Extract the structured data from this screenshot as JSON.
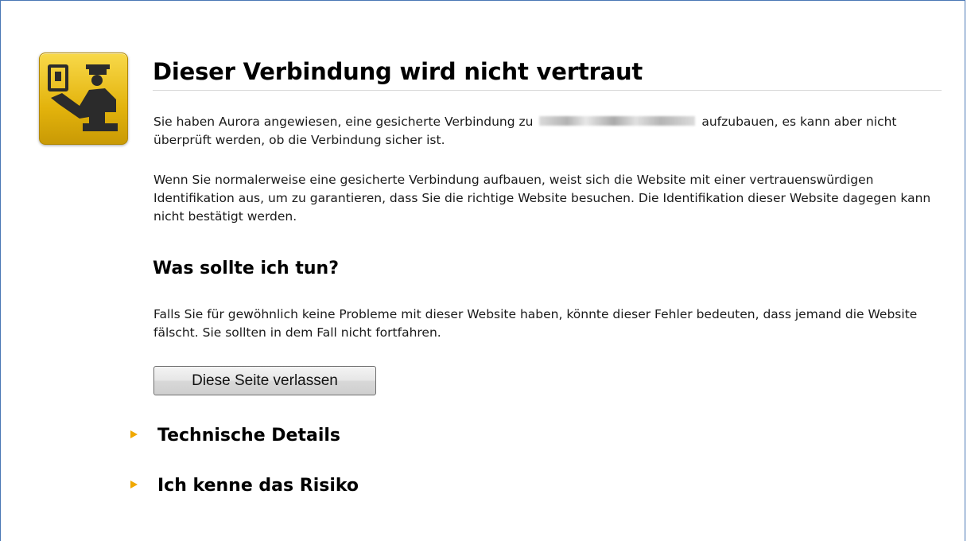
{
  "page": {
    "title": "Dieser Verbindung wird nicht vertraut",
    "intro_before_host": "Sie haben Aurora angewiesen, eine gesicherte Verbindung zu",
    "intro_after_host": "aufzubauen, es kann aber nicht überprüft werden, ob die Verbindung sicher ist.",
    "explanation": "Wenn Sie normalerweise eine gesicherte Verbindung aufbauen, weist sich die Website mit einer vertrauenswürdigen Identifikation aus, um zu garantieren, dass Sie die richtige Website besuchen. Die Identifikation dieser Website dagegen kann nicht bestätigt werden.",
    "what_to_do_heading": "Was sollte ich tun?",
    "what_to_do_text": "Falls Sie für gewöhnlich keine Probleme mit dieser Website haben, könnte dieser Fehler bedeuten, dass jemand die Website fälscht. Sie sollten in dem Fall nicht fortfahren.",
    "leave_button_label": "Diese Seite verlassen",
    "technical_details_label": "Technische Details",
    "understand_risks_label": "Ich kenne das Risiko"
  },
  "icons": {
    "main_icon": "security-officer-icon",
    "expander_icon": "triangle-right-icon"
  },
  "colors": {
    "icon_yellow": "#e3b30c",
    "expander_triangle": "#f0a800",
    "frame_border": "#4a78b5"
  }
}
